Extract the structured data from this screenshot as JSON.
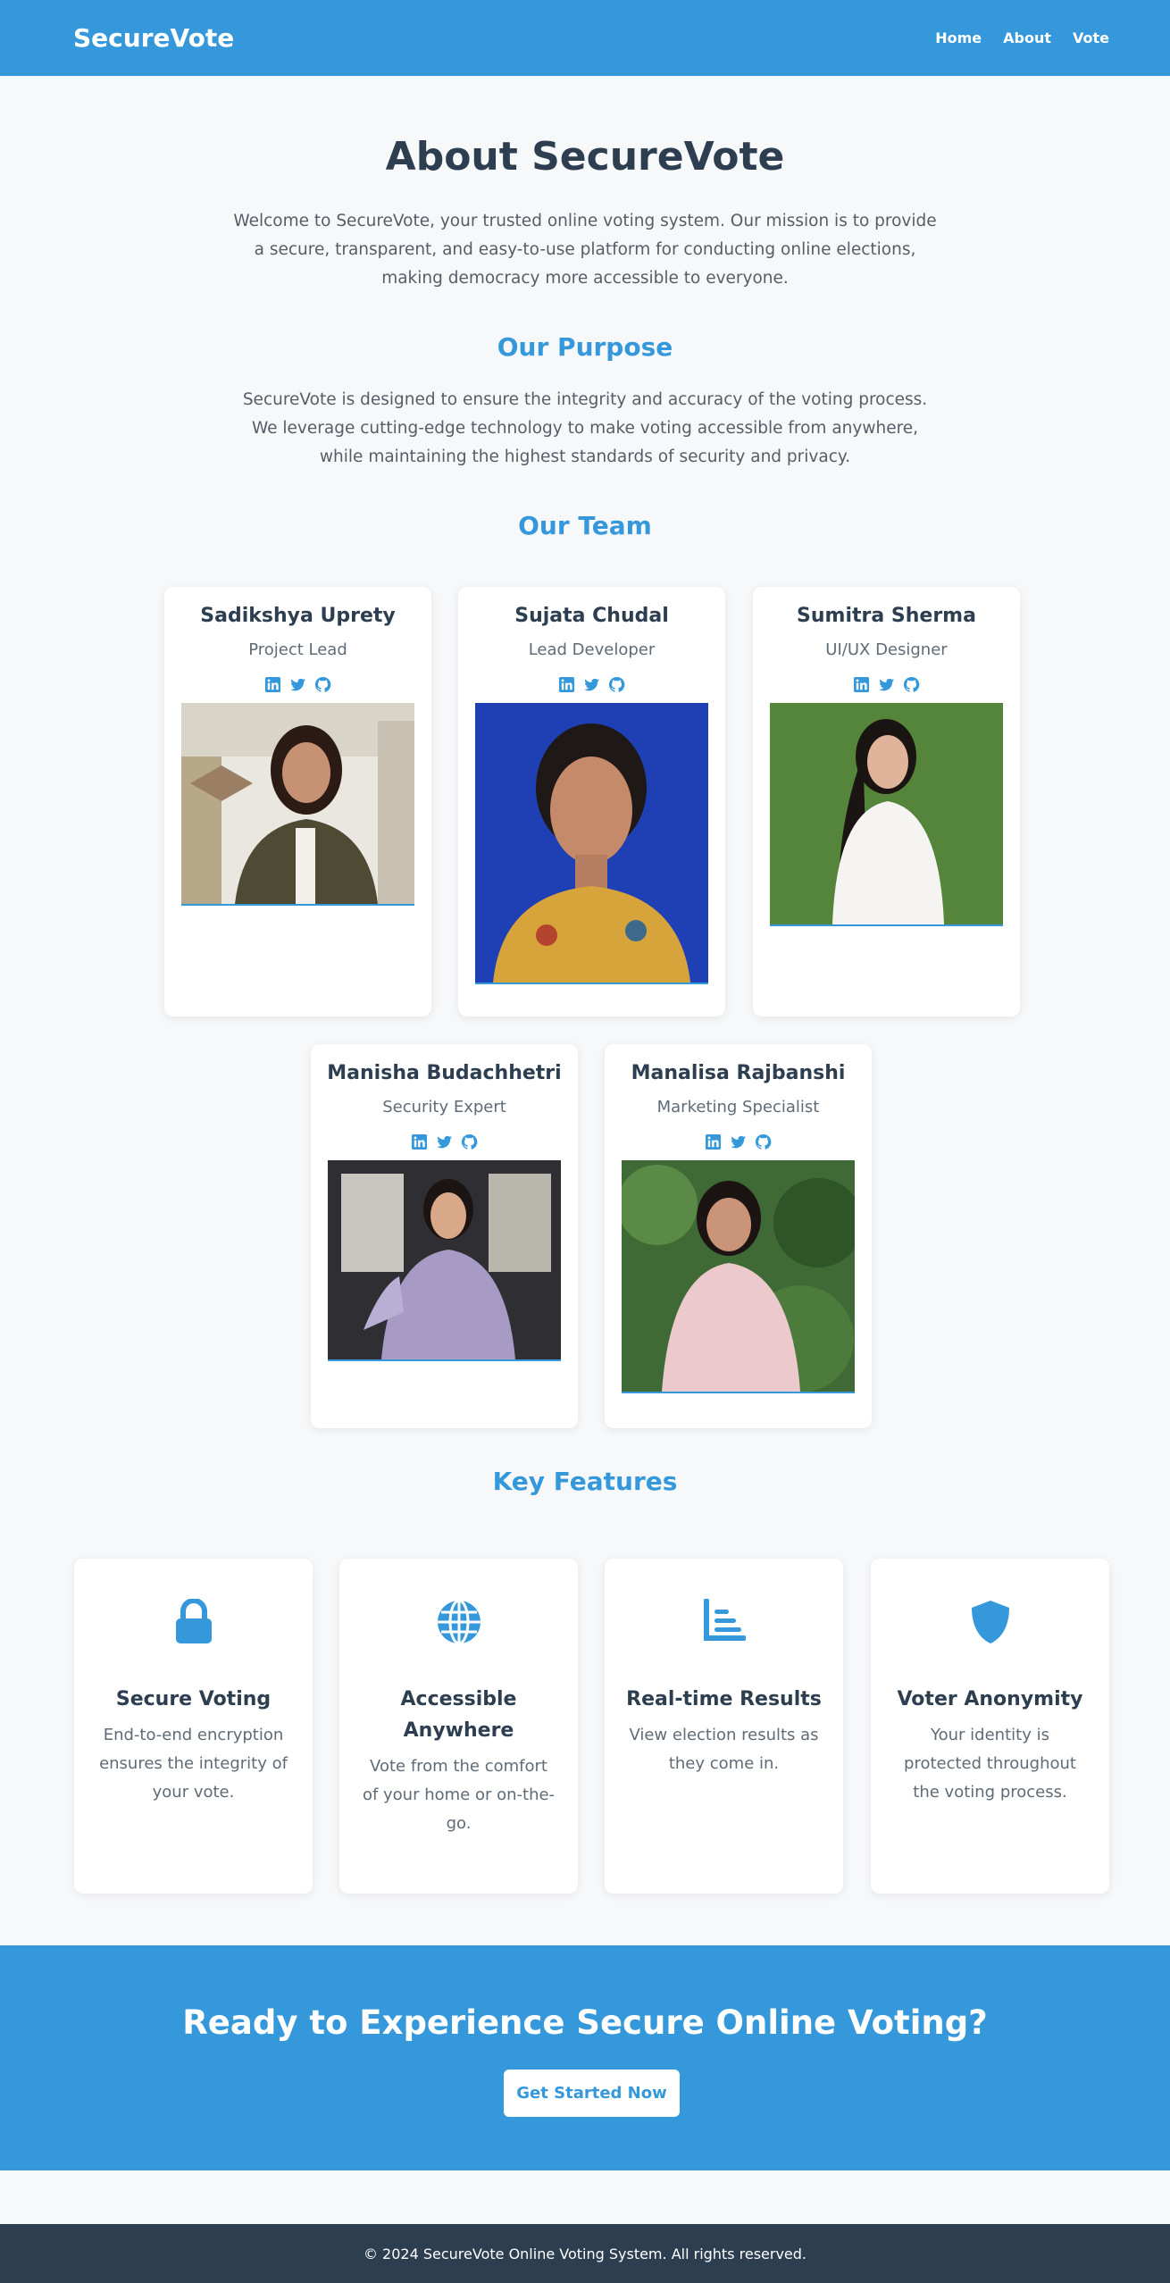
{
  "header": {
    "brand": "SecureVote",
    "links": [
      "Home",
      "About",
      "Vote"
    ]
  },
  "about": {
    "title": "About SecureVote",
    "intro": "Welcome to SecureVote, your trusted online voting system. Our mission is to provide a secure, transparent, and easy-to-use platform for conducting online elections, making democracy more accessible to everyone."
  },
  "purpose": {
    "title": "Our Purpose",
    "text": "SecureVote is designed to ensure the integrity and accuracy of the voting process. We leverage cutting-edge technology to make voting accessible from anywhere, while maintaining the highest standards of security and privacy."
  },
  "team": {
    "title": "Our Team",
    "members": [
      {
        "name": "Sadikshya Uprety",
        "role": "Project Lead",
        "socials": [
          "linkedin-icon",
          "twitter-icon",
          "github-icon"
        ]
      },
      {
        "name": "Sujata Chudal",
        "role": "Lead Developer",
        "socials": [
          "linkedin-icon",
          "twitter-icon",
          "github-icon"
        ]
      },
      {
        "name": "Sumitra Sherma",
        "role": "UI/UX Designer",
        "socials": [
          "linkedin-icon",
          "twitter-icon",
          "github-icon"
        ]
      },
      {
        "name": "Manisha Budachhetri",
        "role": "Security Expert",
        "socials": [
          "linkedin-icon",
          "twitter-icon",
          "github-icon"
        ]
      },
      {
        "name": "Manalisa Rajbanshi",
        "role": "Marketing Specialist",
        "socials": [
          "linkedin-icon",
          "twitter-icon",
          "github-icon"
        ]
      }
    ]
  },
  "features": {
    "title": "Key Features",
    "items": [
      {
        "icon": "lock-icon",
        "title": "Secure Voting",
        "desc": "End-to-end encryption ensures the integrity of your vote."
      },
      {
        "icon": "globe-icon",
        "title": "Accessible Anywhere",
        "desc": "Vote from the comfort of your home or on-the-go."
      },
      {
        "icon": "bar-chart-icon",
        "title": "Real-time Results",
        "desc": "View election results as they come in."
      },
      {
        "icon": "shield-icon",
        "title": "Voter Anonymity",
        "desc": "Your identity is protected throughout the voting process."
      }
    ]
  },
  "cta": {
    "title": "Ready to Experience Secure Online Voting?",
    "button": "Get Started Now"
  },
  "footer": {
    "text": "© 2024 SecureVote Online Voting System. All rights reserved."
  },
  "colors": {
    "primary": "#3498db",
    "dark": "#2c3e50",
    "background": "#f7f8fa"
  }
}
